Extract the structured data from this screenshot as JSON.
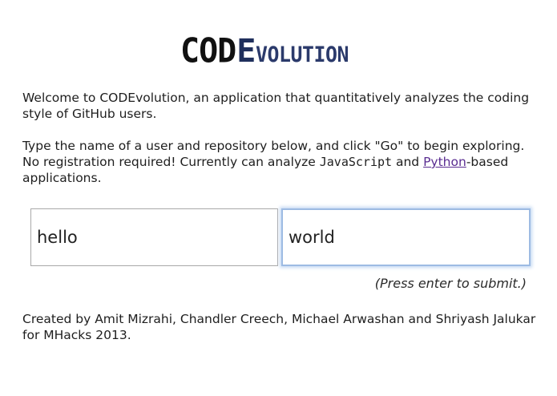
{
  "logo": {
    "part1": "COD",
    "part2": "E",
    "part3": "VOLUTION"
  },
  "intro": {
    "text": "Welcome to CODEvolution, an application that quantitatively analyzes the coding style of GitHub users."
  },
  "instructions": {
    "before": "Type the name of a user and repository below, and click \"Go\" to begin exploring. No registration required! Currently can analyze ",
    "javascript": "JavaScript",
    "and": " and ",
    "python_link": "Python",
    "after": "-based applications."
  },
  "form": {
    "user_value": "hello",
    "repo_value": "world",
    "hint": "(Press enter to submit.)"
  },
  "credits": {
    "text": "Created by Amit Mizrahi, Chandler Creech, Michael Arwashan and Shriyash Jalukar for MHacks 2013."
  },
  "colors": {
    "logo_dark": "#111111",
    "logo_blue": "#2b3a6b",
    "link": "#5a2d91",
    "focus_border": "#9dbbe3"
  }
}
